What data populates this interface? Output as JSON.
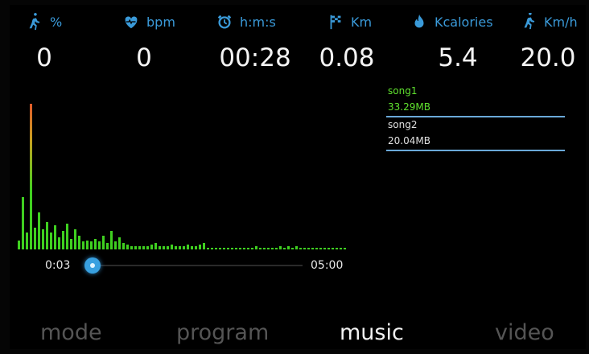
{
  "stats": [
    {
      "icon": "runner-icon",
      "unit": "%",
      "value": "0"
    },
    {
      "icon": "heart-rate-icon",
      "unit": "bpm",
      "value": "0"
    },
    {
      "icon": "alarm-clock-icon",
      "unit": "h:m:s",
      "value": "00:28"
    },
    {
      "icon": "checkered-flag-icon",
      "unit": "Km",
      "value": "0.08"
    },
    {
      "icon": "flame-icon",
      "unit": "Kcalories",
      "value": "5.4"
    },
    {
      "icon": "speed-runner-icon",
      "unit": "Km/h",
      "value": "20.0"
    }
  ],
  "player": {
    "current_time": "0:03",
    "total_time": "05:00",
    "progress": 0.01
  },
  "visualizer": {
    "levels": [
      0.06,
      0.34,
      0.11,
      0.95,
      0.14,
      0.24,
      0.13,
      0.18,
      0.11,
      0.16,
      0.08,
      0.12,
      0.17,
      0.07,
      0.13,
      0.09,
      0.05,
      0.06,
      0.05,
      0.07,
      0.05,
      0.09,
      0.04,
      0.12,
      0.05,
      0.08,
      0.04,
      0.03,
      0.02,
      0.02,
      0.02,
      0.02,
      0.02,
      0.03,
      0.04,
      0.02,
      0.02,
      0.02,
      0.03,
      0.02,
      0.02,
      0.02,
      0.03,
      0.02,
      0.02,
      0.03,
      0.04,
      0.01,
      0.01,
      0.01,
      0.01,
      0.01,
      0.01,
      0.01,
      0.01,
      0.01,
      0.01,
      0.01,
      0.01,
      0.02,
      0.01,
      0.01,
      0.01,
      0.01,
      0.01,
      0.02,
      0.01,
      0.02,
      0.01,
      0.02,
      0.01,
      0.01,
      0.01,
      0.01,
      0.01,
      0.01,
      0.01,
      0.01,
      0.01,
      0.01,
      0.01,
      0.01
    ],
    "bar_color": "#3fd020",
    "peak_color": "#e05a2a"
  },
  "playlist": [
    {
      "name": "song1",
      "size": "33.29MB",
      "active": true
    },
    {
      "name": "song2",
      "size": "20.04MB",
      "active": false
    }
  ],
  "nav": [
    {
      "label": "mode",
      "active": false
    },
    {
      "label": "program",
      "active": false
    },
    {
      "label": "music",
      "active": true
    },
    {
      "label": "video",
      "active": false
    }
  ],
  "colors": {
    "accent": "#3a9ad9",
    "active_song": "#5fe12e",
    "inactive_nav": "#555555"
  }
}
